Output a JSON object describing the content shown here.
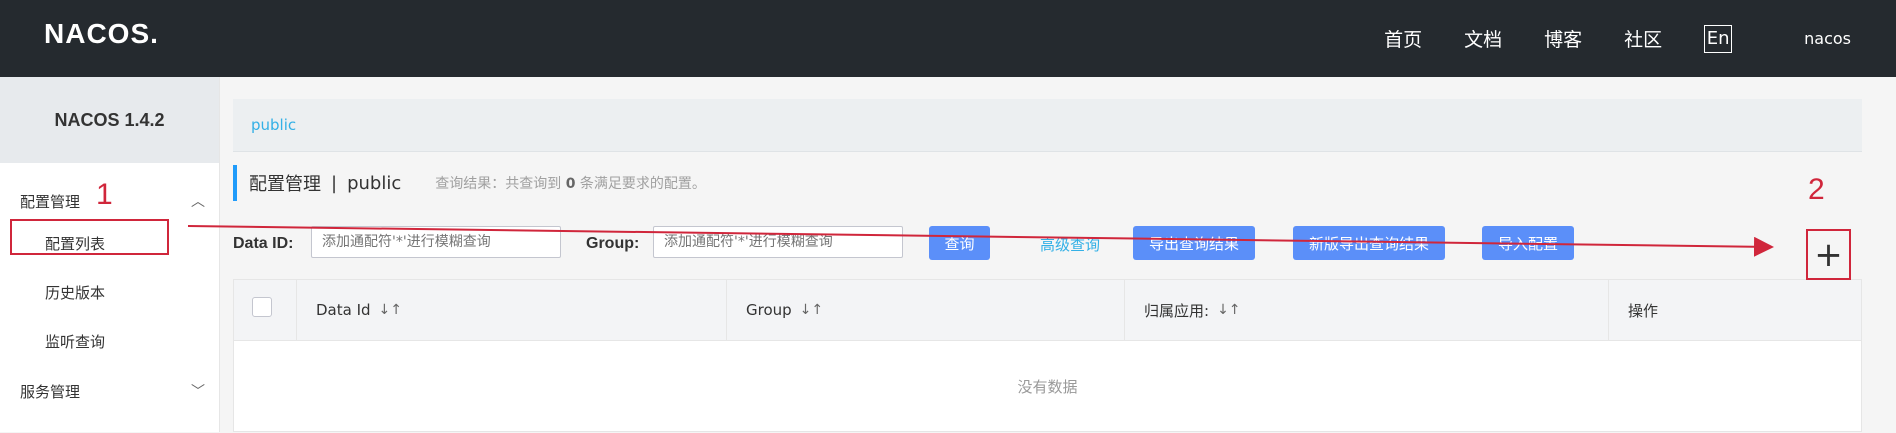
{
  "header": {
    "logo_text": "NACOS.",
    "nav": [
      {
        "label": "首页"
      },
      {
        "label": "文档"
      },
      {
        "label": "博客"
      },
      {
        "label": "社区"
      }
    ],
    "lang": "En",
    "user": "nacos"
  },
  "sidebar": {
    "title": "NACOS 1.4.2",
    "config_group": "配置管理",
    "items": [
      {
        "label": "配置列表"
      },
      {
        "label": "历史版本"
      },
      {
        "label": "监听查询"
      }
    ],
    "service_group": "服务管理"
  },
  "main": {
    "namespace": "public",
    "page_title": "配置管理",
    "page_sep": "|",
    "page_namespace": "public",
    "count_prefix": "查询结果：共查询到",
    "count": "0",
    "count_suffix": "条满足要求的配置。",
    "filter": {
      "dataid_label": "Data ID:",
      "dataid_placeholder": "添加通配符'*'进行模糊查询",
      "group_label": "Group:",
      "group_placeholder": "添加通配符'*'进行模糊查询",
      "query": "查询",
      "advanced": "高级查询",
      "export": "导出查询结果",
      "export_new": "新版导出查询结果",
      "import": "导入配置"
    },
    "table": {
      "columns": [
        "Data Id",
        "Group",
        "归属应用:",
        "操作"
      ],
      "empty": "没有数据"
    },
    "add_button": "+"
  },
  "annotations": {
    "n1": "1",
    "n2": "2",
    "color": "#d0263b"
  }
}
